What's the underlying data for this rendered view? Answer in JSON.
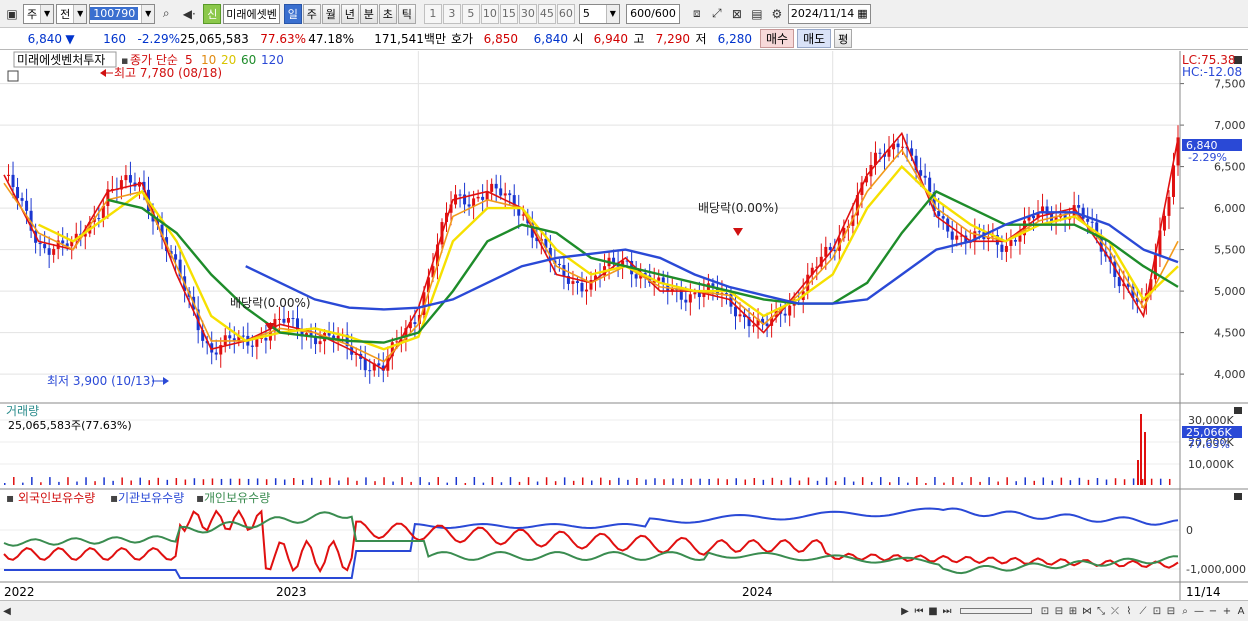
{
  "toolbar": {
    "period_type": "주",
    "prev_label": "전",
    "code": "100790",
    "shin_label": "신",
    "stock_short": "미래에셋벤",
    "period_tabs": [
      "일",
      "주",
      "월",
      "년",
      "분",
      "초",
      "틱"
    ],
    "active_tab": "일",
    "intervals": [
      "1",
      "3",
      "5",
      "10",
      "15",
      "30",
      "45",
      "60"
    ],
    "interval_select": "5",
    "count": "600/600",
    "date": "2024/11/14"
  },
  "quote": {
    "price": "6,840",
    "arrow": "▼",
    "change": "160",
    "change_pct": "-2.29%",
    "volume": "25,065,583",
    "vol_ratio": "77.63%",
    "turnover": "47.18%",
    "amount": "171,541백만",
    "ask_label": "호가",
    "ask1": "6,850",
    "ask2": "6,840",
    "open_label": "시",
    "open": "6,940",
    "high_label": "고",
    "high": "7,290",
    "low_label": "저",
    "low": "6,280",
    "buy_label": "매수",
    "sell_label": "매도",
    "avg_label": "평"
  },
  "price_panel": {
    "stock_name": "미래에셋벤처투자",
    "ma_label": "종가 단순",
    "ma_periods": [
      "5",
      "10",
      "20",
      "60",
      "120"
    ],
    "lc_text": "LC:75.38",
    "hc_text": "HC:-12.08",
    "current_value": "6,840",
    "current_pct": "-2.29%",
    "high_annotation": "최고 7,780 (08/18)",
    "low_annotation": "최저 3,900 (10/13)",
    "dividend_1": "배당락(0.00%)",
    "dividend_2": "배당락(0.00%)"
  },
  "volume_panel": {
    "title": "거래량",
    "value_text": "25,065,583주(77.63%)",
    "current_value": "25,066K",
    "current_pct": "77.63%"
  },
  "holdings_panel": {
    "labels": [
      "외국인보유수량",
      "기관보유수량",
      "개인보유수량"
    ]
  },
  "x_axis": {
    "labels": [
      "2022",
      "2023",
      "2024"
    ],
    "end_label": "11/14"
  },
  "colors": {
    "ma5": "#e01010",
    "ma10": "#f29a1a",
    "ma20": "#f6e000",
    "ma60": "#1e8c2a",
    "ma120": "#2a49d6",
    "candle_up": "#e01010",
    "candle_dn": "#1a36d0",
    "foreign": "#2a49d6",
    "institution": "#e01010",
    "individual": "#3a8c50"
  },
  "chart_data": [
    {
      "type": "line",
      "title": "미래에셋벤처투자",
      "x": [
        "2022-01",
        "2022-02",
        "2022-03",
        "2022-04",
        "2022-05",
        "2022-06",
        "2022-07",
        "2022-08",
        "2022-09",
        "2022-10",
        "2022-11",
        "2022-12",
        "2023-01",
        "2023-02",
        "2023-03",
        "2023-04",
        "2023-05",
        "2023-06",
        "2023-07",
        "2023-08",
        "2023-09",
        "2023-10",
        "2023-11",
        "2023-12",
        "2024-01",
        "2024-02",
        "2024-03",
        "2024-04",
        "2024-05",
        "2024-06",
        "2024-07",
        "2024-08",
        "2024-09",
        "2024-10",
        "2024-11"
      ],
      "series": [
        {
          "name": "5",
          "values": [
            6400,
            5600,
            5500,
            6200,
            6300,
            5200,
            4300,
            4400,
            4600,
            4500,
            4300,
            4050,
            4800,
            6100,
            6200,
            6000,
            5200,
            5100,
            5400,
            5000,
            5000,
            4900,
            4500,
            5000,
            5500,
            6400,
            6900,
            5900,
            5600,
            5600,
            5900,
            6000,
            5400,
            4700,
            6840
          ]
        },
        {
          "name": "10",
          "values": [
            6300,
            5700,
            5500,
            6100,
            6200,
            5300,
            4400,
            4400,
            4550,
            4500,
            4350,
            4150,
            4600,
            5900,
            6100,
            6000,
            5300,
            5100,
            5300,
            5050,
            5000,
            4950,
            4600,
            4950,
            5400,
            6200,
            6700,
            6000,
            5700,
            5600,
            5850,
            5950,
            5500,
            4800,
            5600
          ]
        },
        {
          "name": "20",
          "values": [
            null,
            5800,
            5600,
            5900,
            6200,
            5600,
            4700,
            4400,
            4500,
            4550,
            4450,
            4300,
            4450,
            5600,
            6000,
            6000,
            5500,
            5200,
            5300,
            5100,
            5000,
            5000,
            4700,
            4900,
            5200,
            6000,
            6500,
            6100,
            5800,
            5600,
            5800,
            5900,
            5600,
            4900,
            5300
          ]
        },
        {
          "name": "60",
          "values": [
            null,
            null,
            null,
            6100,
            6000,
            5700,
            5200,
            4800,
            4500,
            4450,
            4400,
            4380,
            4500,
            5000,
            5600,
            5800,
            5700,
            5400,
            5300,
            5200,
            5100,
            5000,
            4900,
            4850,
            4850,
            5100,
            5700,
            6200,
            6000,
            5800,
            5800,
            5800,
            5600,
            5300,
            5050
          ]
        },
        {
          "name": "120",
          "values": [
            null,
            null,
            null,
            null,
            null,
            null,
            null,
            5300,
            5100,
            4900,
            4800,
            4780,
            4800,
            4900,
            5100,
            5300,
            5400,
            5450,
            5500,
            5400,
            5200,
            5050,
            4950,
            4850,
            4850,
            4900,
            5200,
            5500,
            5600,
            5800,
            5950,
            5950,
            5800,
            5500,
            5350
          ]
        }
      ],
      "ylim": [
        3700,
        7700
      ],
      "y_ticks": [
        4000,
        4500,
        5000,
        5500,
        6000,
        6500,
        7000,
        7500
      ],
      "grid": true
    },
    {
      "type": "bar",
      "title": "거래량",
      "y_ticks_labels": [
        "10,000K",
        "20,000K",
        "30,000K"
      ],
      "notable_values_k": {
        "2024-11-14": 25066
      }
    },
    {
      "type": "line",
      "series": [
        {
          "name": "외국인보유수량"
        },
        {
          "name": "기관보유수량"
        },
        {
          "name": "개인보유수량"
        }
      ],
      "y_ticks_labels": [
        "0",
        "-1,000,000"
      ]
    }
  ]
}
